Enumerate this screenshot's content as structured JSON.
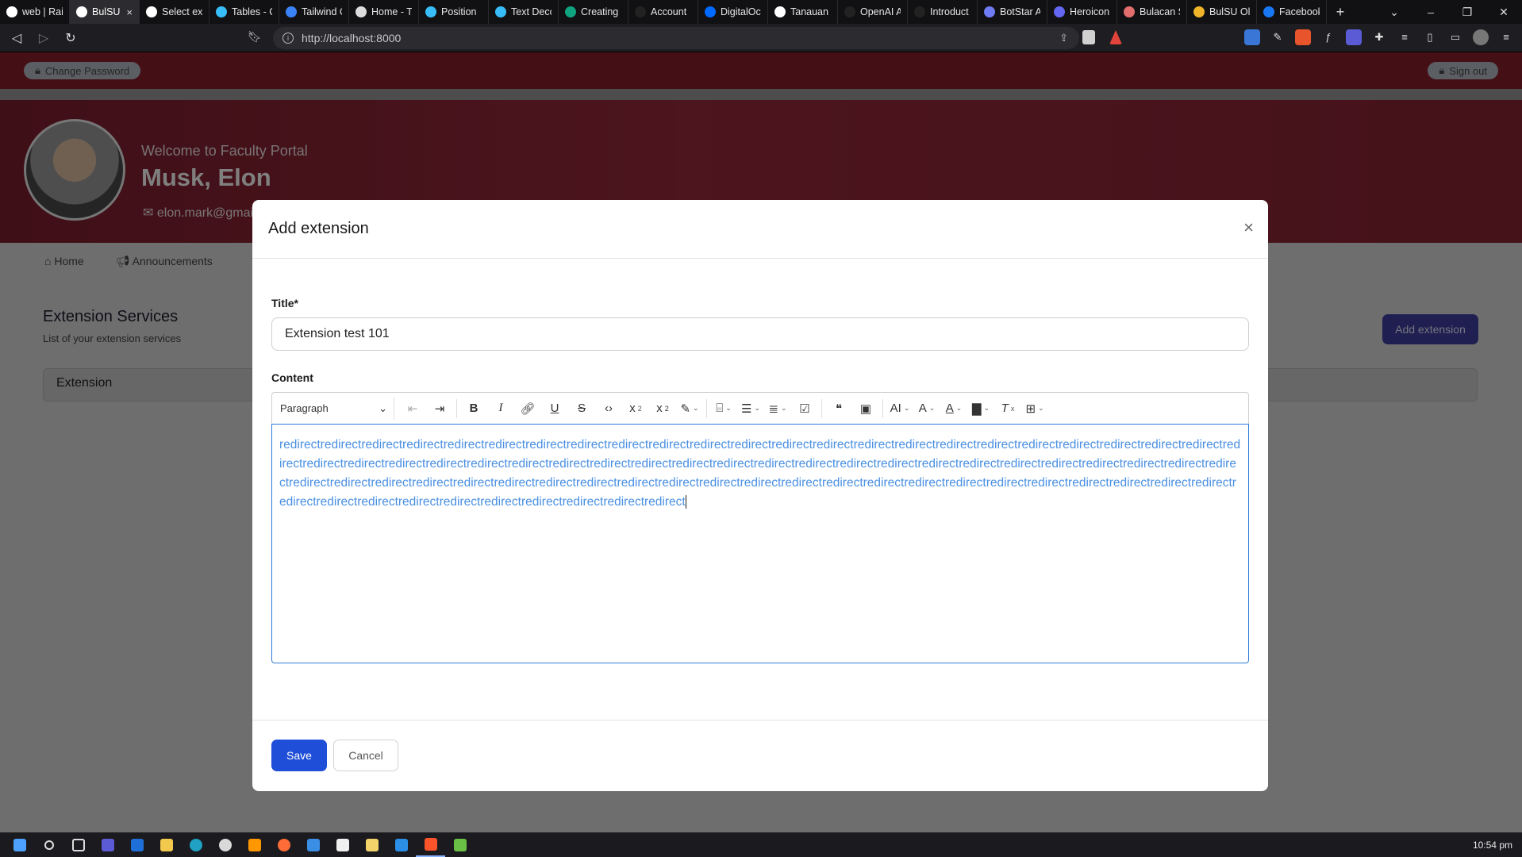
{
  "browser": {
    "tabs": [
      {
        "title": "web | Rai",
        "color": "#ffffff",
        "active": false
      },
      {
        "title": "BulSU",
        "color": "#ffffff",
        "active": true
      },
      {
        "title": "Select ext",
        "color": "#ffffff",
        "active": false
      },
      {
        "title": "Tables - C",
        "color": "#38bdf8",
        "active": false
      },
      {
        "title": "Tailwind C",
        "color": "#3b82f6",
        "active": false
      },
      {
        "title": "Home - T",
        "color": "#dddddd",
        "active": false
      },
      {
        "title": "Position",
        "color": "#38bdf8",
        "active": false
      },
      {
        "title": "Text Deco",
        "color": "#38bdf8",
        "active": false
      },
      {
        "title": "Creating",
        "color": "#10a37f",
        "active": false
      },
      {
        "title": "Account",
        "color": "#222222",
        "active": false
      },
      {
        "title": "DigitalOc",
        "color": "#0069ff",
        "active": false
      },
      {
        "title": "Tanauan",
        "color": "#ffffff",
        "active": false
      },
      {
        "title": "OpenAI A",
        "color": "#222222",
        "active": false
      },
      {
        "title": "Introduct",
        "color": "#222222",
        "active": false
      },
      {
        "title": "BotStar A",
        "color": "#6e7bf2",
        "active": false
      },
      {
        "title": "Heroicon",
        "color": "#6366f1",
        "active": false
      },
      {
        "title": "Bulacan S",
        "color": "#e26d6d",
        "active": false
      },
      {
        "title": "BulSU Ol",
        "color": "#f0b429",
        "active": false
      },
      {
        "title": "Facebook",
        "color": "#1877f2",
        "active": false
      }
    ],
    "tab_close": "×",
    "new_tab": "+",
    "url": "http://localhost:8000",
    "clock": "10:54 pm"
  },
  "header": {
    "change_password": "Change Password",
    "sign_out": "Sign out"
  },
  "profile": {
    "welcome": "Welcome to Faculty Portal",
    "name": "Musk, Elon",
    "email": "elon.mark@gmail.com"
  },
  "nav": {
    "home": "Home",
    "announcements": "Announcements"
  },
  "services": {
    "title": "Extension Services",
    "subtitle": "List of your extension services",
    "add_button": "Add extension",
    "table_header": "Extension"
  },
  "modal": {
    "title": "Add extension",
    "close": "×",
    "title_label": "Title*",
    "title_value": "Extension test 101",
    "content_label": "Content",
    "paragraph_select": "Paragraph",
    "content_text": "redirectredirectredirectredirectredirectredirectredirectredirectredirectredirectredirectredirectredirectredirectredirectredirectredirectredirectredirectredirectredirectredirectredirectredirectredirectredirectredirectredirectredirectredirectredirectredirectredirectredirectredirectredirectredirectredirectredirectredirectredirectredirectredirectredirectredirectredirectredirectredirectredirectredirectredirectredirectredirectredirectredirectredirectredirectredirectredirectredirectredirectredirectredirectredirectredirectredirectredirectredirectredirectredirectredirectredirectredirectredirectredirectredirectredirectredirectredirectredirect",
    "save": "Save",
    "cancel": "Cancel"
  },
  "colors": {
    "accent": "#1f4fd8",
    "brand": "#8a1f2c",
    "editor_text": "#4a90e2"
  }
}
